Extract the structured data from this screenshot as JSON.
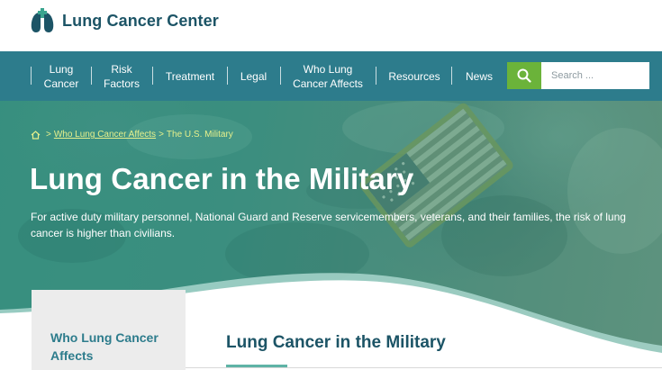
{
  "site": {
    "name": "Lung Cancer Center"
  },
  "nav": {
    "items": [
      {
        "line1": "Lung",
        "line2": "Cancer"
      },
      {
        "line1": "Risk",
        "line2": "Factors"
      },
      {
        "line1": "Treatment",
        "line2": ""
      },
      {
        "line1": "Legal",
        "line2": ""
      },
      {
        "line1": "Who Lung",
        "line2": "Cancer Affects"
      },
      {
        "line1": "Resources",
        "line2": ""
      },
      {
        "line1": "News",
        "line2": ""
      }
    ]
  },
  "search": {
    "placeholder": "Search ..."
  },
  "breadcrumb": {
    "link": "Who Lung Cancer Affects",
    "separator": ">",
    "current": "The U.S. Military"
  },
  "hero": {
    "title": "Lung Cancer in the Military",
    "subtitle": "For active duty military personnel, National Guard and Reserve servicemembers, veterans, and their families, the risk of lung cancer is higher than civilians."
  },
  "sidebar": {
    "title": "Who Lung Cancer Affects"
  },
  "content": {
    "title": "Lung Cancer in the Military"
  },
  "colors": {
    "brand_dark": "#1c5466",
    "nav_bg": "#2d7c8c",
    "search_button": "#6bb33a",
    "breadcrumb": "#e6f08c",
    "accent_teal": "#5fb3a6"
  },
  "icons": {
    "logo": "lungs-icon",
    "search": "search-icon",
    "home": "home-icon"
  }
}
